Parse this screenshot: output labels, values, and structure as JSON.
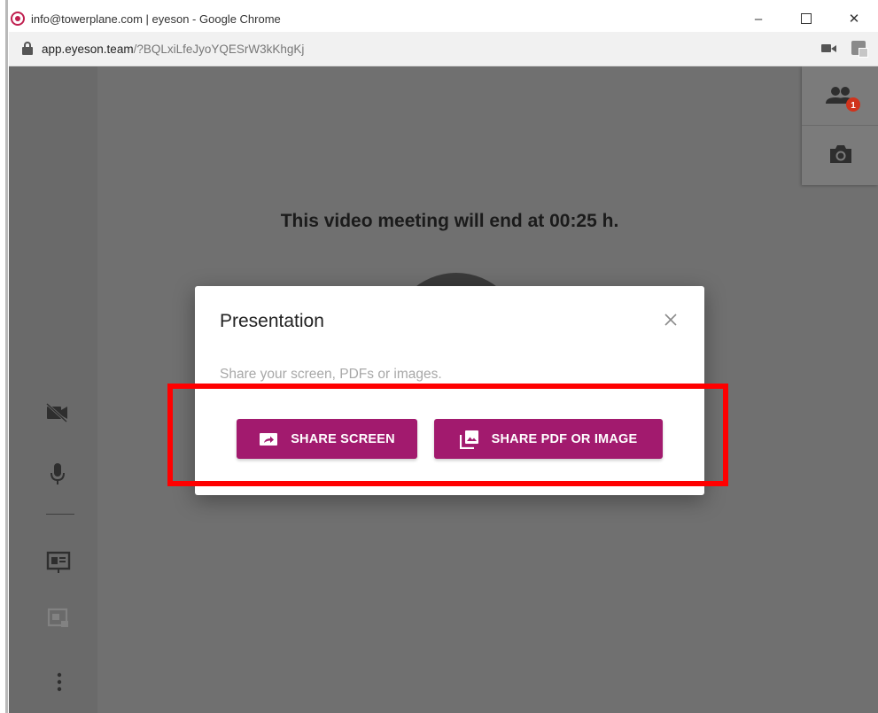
{
  "window": {
    "title": "info@towerplane.com | eyeson - Google Chrome",
    "controls": {
      "minimize": "–",
      "close": "✕"
    }
  },
  "addressbar": {
    "host": "app.eyeson.team",
    "path": "/?BQLxiLfeJyoYQESrW3kKhgKj"
  },
  "meeting": {
    "end_notice": "This video meeting will end at 00:25 h."
  },
  "participants": {
    "badge_count": "1"
  },
  "dialog": {
    "title": "Presentation",
    "description": "Share your screen, PDFs or images.",
    "share_screen_label": "SHARE SCREEN",
    "share_pdf_label": "SHARE PDF OR IMAGE"
  },
  "colors": {
    "accent": "#a21a6e",
    "highlight": "#ff0000",
    "badge": "#d0331c"
  }
}
